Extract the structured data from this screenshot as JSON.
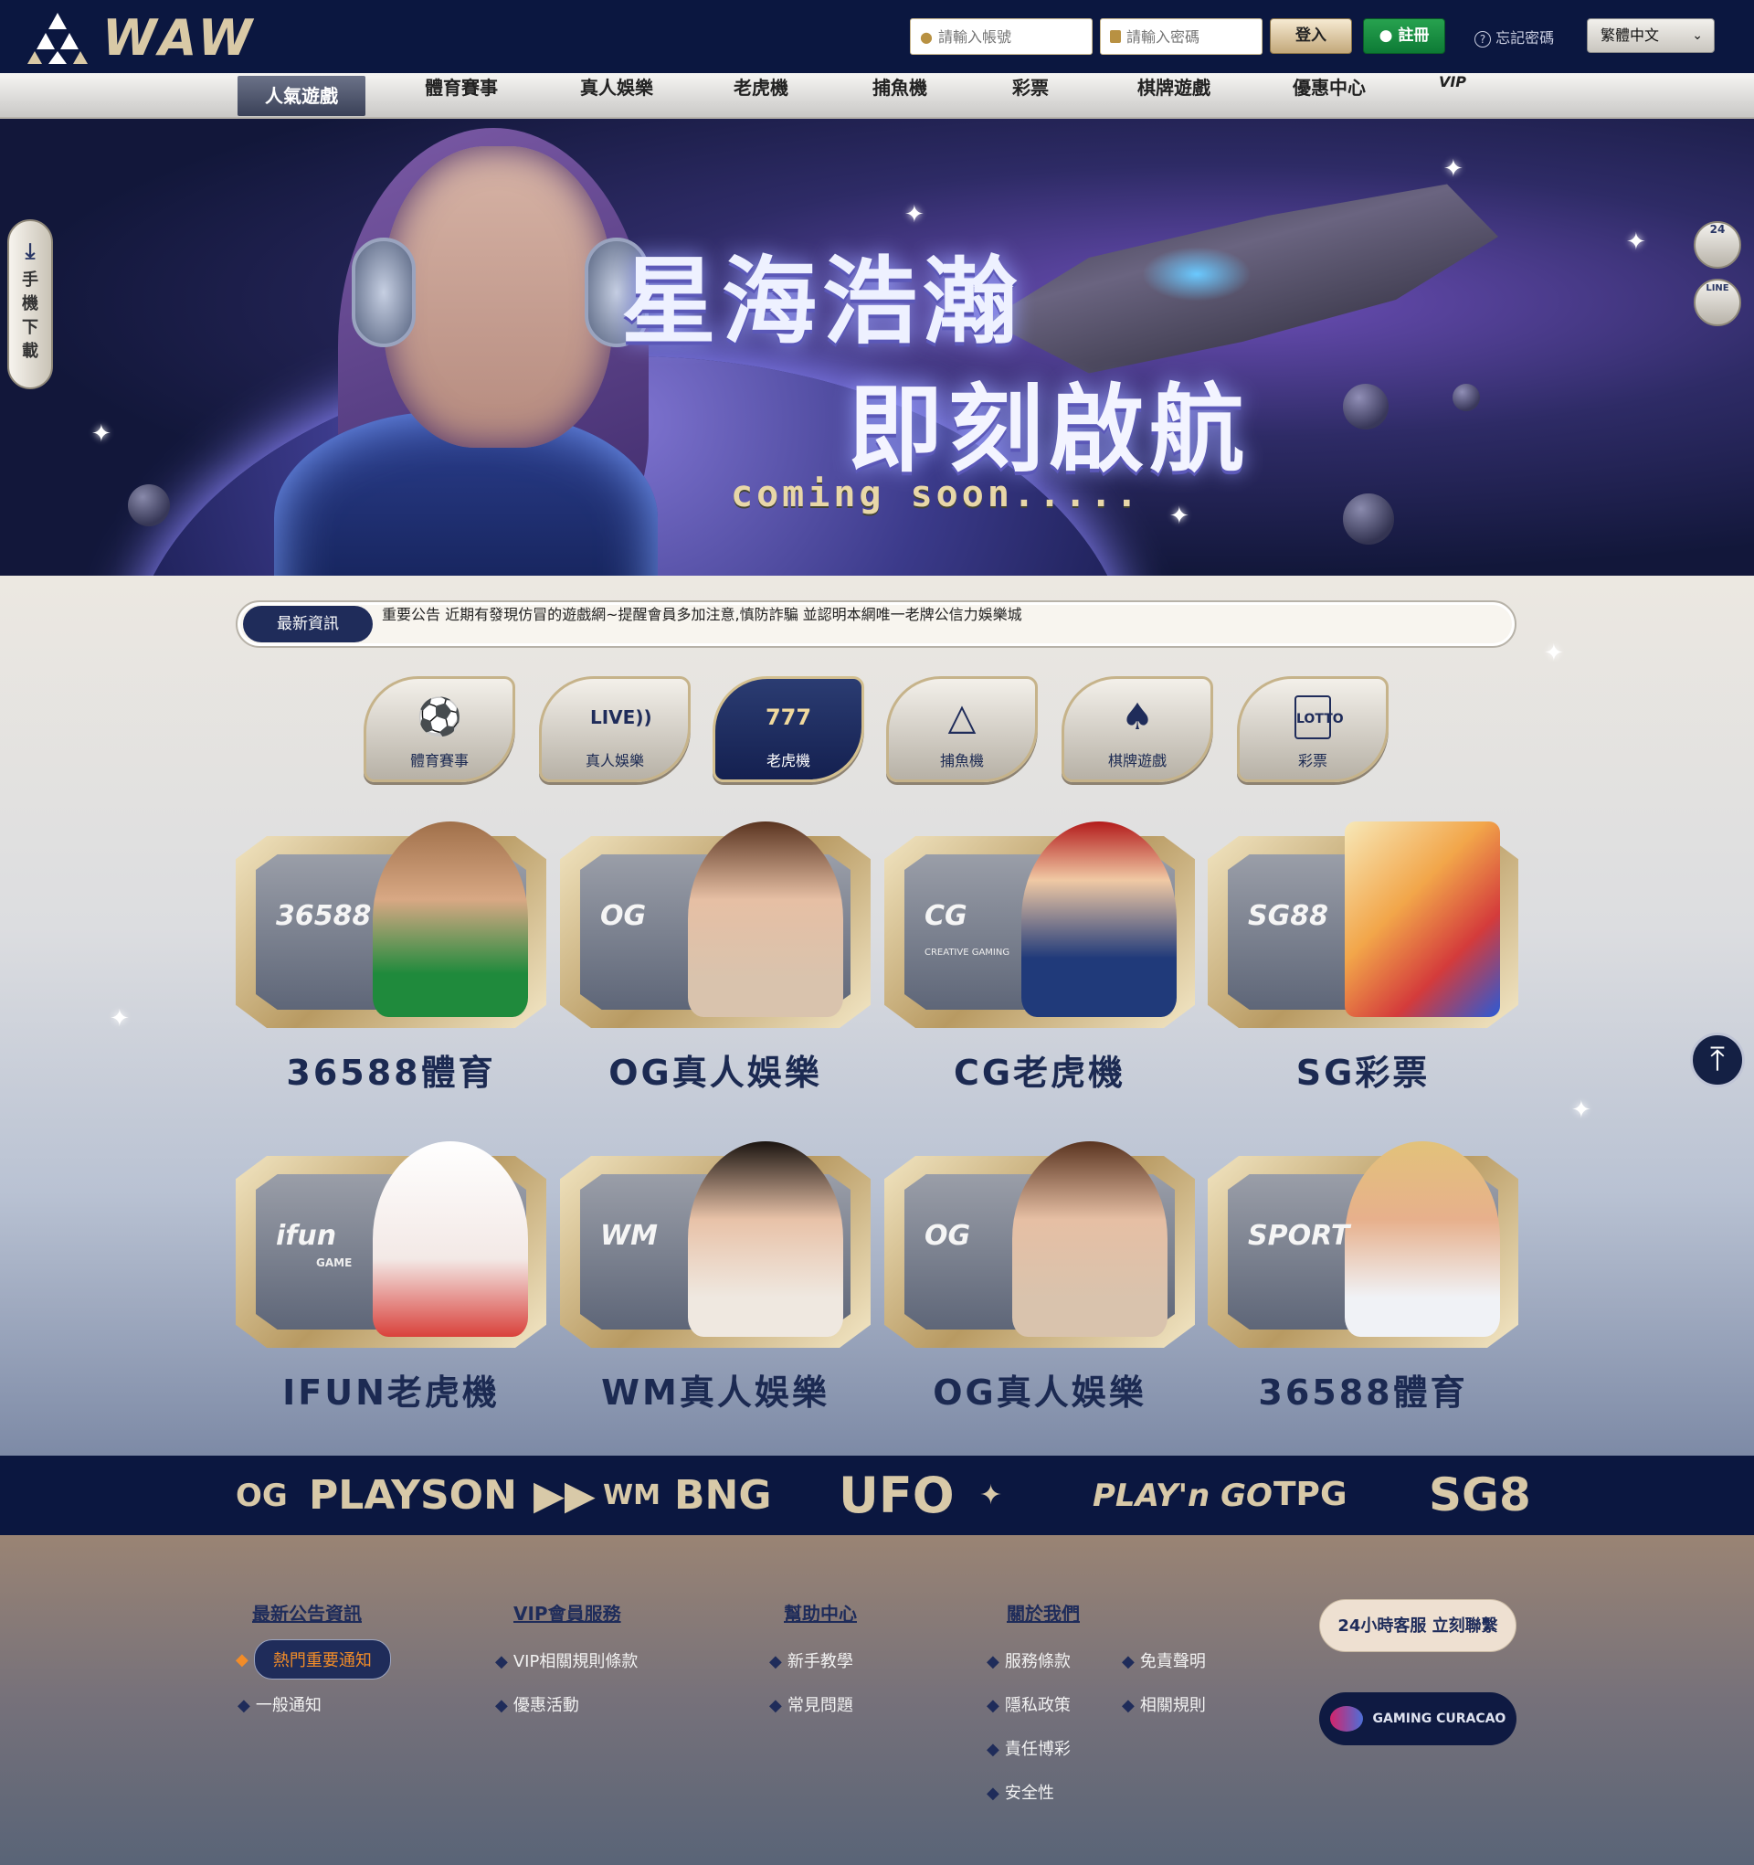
{
  "header": {
    "logo_text": "WAW",
    "username_placeholder": "請輸入帳號",
    "password_placeholder": "請輸入密碼",
    "login_label": "登入",
    "register_label": "註冊",
    "forgot_label": "忘記密碼",
    "language": "繁體中文"
  },
  "nav": {
    "items": [
      "人氣遊戲",
      "體育賽事",
      "真人娛樂",
      "老虎機",
      "捕魚機",
      "彩票",
      "棋牌遊戲",
      "優惠中心",
      "VIP"
    ],
    "active": "人氣遊戲"
  },
  "banner": {
    "title_line1": "星海浩瀚",
    "title_line2": "即刻啟航",
    "subtitle": "coming soon....."
  },
  "side": {
    "download_label": "手機下載",
    "service_24_label": "24",
    "line_label": "LINE"
  },
  "news": {
    "label": "最新資訊",
    "text": "重要公告 近期有發現仿冒的遊戲網~提醒會員多加注意,慎防詐騙 並認明本網唯一老牌公信力娛樂城"
  },
  "categories": [
    {
      "label": "體育賽事",
      "icon": "soccer-ball-icon"
    },
    {
      "label": "真人娛樂",
      "icon": "live-icon"
    },
    {
      "label": "老虎機",
      "icon": "slot-777-icon",
      "active": true
    },
    {
      "label": "捕魚機",
      "icon": "fish-icon"
    },
    {
      "label": "棋牌遊戲",
      "icon": "playing-card-icon"
    },
    {
      "label": "彩票",
      "icon": "lotto-icon"
    }
  ],
  "games": [
    {
      "title": "36588體育",
      "logo": "36588"
    },
    {
      "title": "OG真人娛樂",
      "logo": "OG"
    },
    {
      "title": "CG老虎機",
      "logo": "CG",
      "logo_sub": "CREATIVE GAMING"
    },
    {
      "title": "SG彩票",
      "logo": "SG88"
    },
    {
      "title": "IFUN老虎機",
      "logo": "ifun",
      "logo_sub": "GAME"
    },
    {
      "title": "WM真人娛樂",
      "logo": "WM"
    },
    {
      "title": "OG真人娛樂",
      "logo": "OG"
    },
    {
      "title": "36588體育",
      "logo": "SPORT"
    }
  ],
  "partners": [
    "OG",
    "PLAYSON",
    "WM",
    "BNG",
    "UFO",
    "PLAY'n GO",
    "TPG",
    "SG8"
  ],
  "footer": {
    "col1_title": "最新公告資訊",
    "col1_items": [
      "熱門重要通知",
      "一般通知"
    ],
    "col2_title": "VIP會員服務",
    "col2_items": [
      "VIP相關規則條款",
      "優惠活動"
    ],
    "col3_title": "幫助中心",
    "col3_items": [
      "新手教學",
      "常見問題"
    ],
    "col4_title": "關於我們",
    "col4_items": [
      "服務條款",
      "隱私政策",
      "責任博彩",
      "安全性"
    ],
    "col5_items": [
      "免責聲明",
      "相關規則"
    ],
    "service_button": "24小時客服 立刻聯繫",
    "license_text": "GAMING CURACAO"
  },
  "colors": {
    "navy": "#0b1740",
    "gold": "#c6b38a",
    "active_nav": "#3a4158",
    "register_green": "#1a8d42",
    "hot_orange": "#f28c28"
  }
}
